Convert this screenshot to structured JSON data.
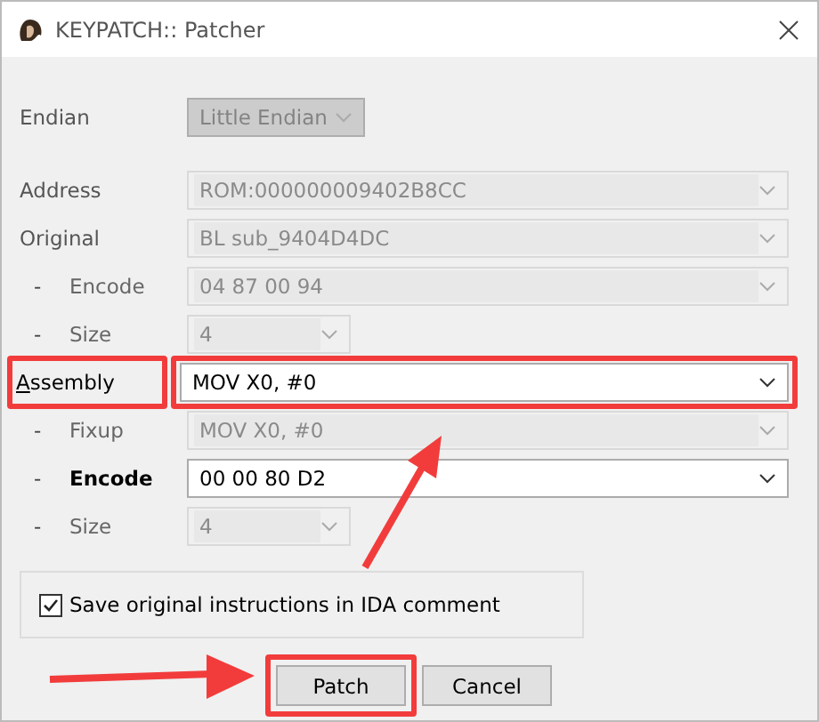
{
  "window": {
    "title": "KEYPATCH:: Patcher"
  },
  "rows": [
    {
      "kind": "compact",
      "prefix": "",
      "label": "Endian",
      "value": "Little Endian",
      "disabled": true,
      "bold": false,
      "highlighted": false
    },
    {
      "kind": "wide",
      "prefix": "",
      "label": "Address",
      "value": "ROM:000000009402B8CC",
      "disabled": true,
      "bold": false,
      "highlighted": false
    },
    {
      "kind": "wide",
      "prefix": "",
      "label": "Original",
      "value": "BL sub_9404D4DC",
      "disabled": true,
      "bold": false,
      "highlighted": false
    },
    {
      "kind": "wide",
      "prefix": "-",
      "label": "Encode",
      "value": "04 87 00 94",
      "disabled": true,
      "bold": false,
      "highlighted": false
    },
    {
      "kind": "narrow",
      "prefix": "-",
      "label": "Size",
      "value": "4",
      "disabled": true,
      "bold": false,
      "highlighted": false
    },
    {
      "kind": "wide",
      "prefix": "",
      "label": "Assembly",
      "value": "MOV X0, #0",
      "disabled": false,
      "bold": false,
      "highlighted": true,
      "underline_first": true
    },
    {
      "kind": "wide",
      "prefix": "-",
      "label": "Fixup",
      "value": "MOV X0, #0",
      "disabled": true,
      "bold": false,
      "highlighted": false
    },
    {
      "kind": "wide",
      "prefix": "-",
      "label": "Encode",
      "value": "00 00 80 D2",
      "disabled": false,
      "bold": true,
      "highlighted": false
    },
    {
      "kind": "narrow",
      "prefix": "-",
      "label": "Size",
      "value": "4",
      "disabled": true,
      "bold": false,
      "highlighted": false
    }
  ],
  "option": {
    "label": "Save original instructions in IDA comment",
    "checked": true
  },
  "buttons": [
    {
      "label": "Patch",
      "highlighted": true
    },
    {
      "label": "Cancel",
      "highlighted": false
    }
  ]
}
